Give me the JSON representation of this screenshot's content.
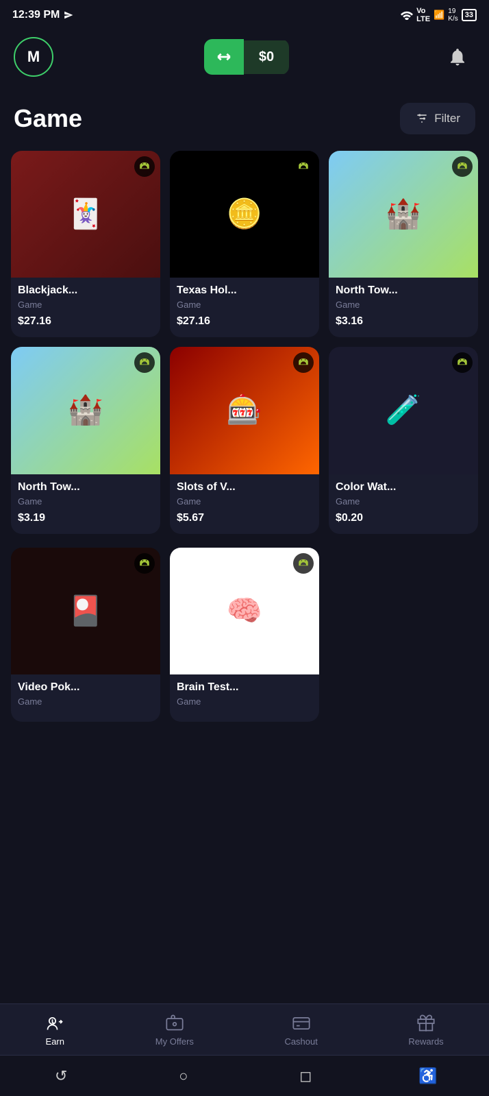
{
  "statusBar": {
    "time": "12:39 PM",
    "battery": "33"
  },
  "header": {
    "avatarLetter": "M",
    "balance": "$0",
    "balanceAriaLabel": "Balance"
  },
  "page": {
    "title": "Game",
    "filterLabel": "Filter"
  },
  "games": [
    {
      "id": "blackjack",
      "name": "Blackjack...",
      "type": "Game",
      "price": "$27.16",
      "bgClass": "game-blackjack",
      "emoji": "🃏"
    },
    {
      "id": "texas",
      "name": "Texas Hol...",
      "type": "Game",
      "price": "$27.16",
      "bgClass": "game-texas",
      "emoji": "🪙"
    },
    {
      "id": "northtow1",
      "name": "North Tow...",
      "type": "Game",
      "price": "$3.16",
      "bgClass": "game-northtow",
      "emoji": "🏰"
    },
    {
      "id": "northtow2",
      "name": "North Tow...",
      "type": "Game",
      "price": "$3.19",
      "bgClass": "game-northtow2",
      "emoji": "🏰"
    },
    {
      "id": "slots",
      "name": "Slots of V...",
      "type": "Game",
      "price": "$5.67",
      "bgClass": "game-slots",
      "emoji": "🎰"
    },
    {
      "id": "colorwater",
      "name": "Color Wat...",
      "type": "Game",
      "price": "$0.20",
      "bgClass": "game-colorwater",
      "emoji": "🧪"
    },
    {
      "id": "videopok",
      "name": "Video Pok...",
      "type": "Game",
      "price": null,
      "bgClass": "game-videopok",
      "emoji": "🎴"
    },
    {
      "id": "braintest",
      "name": "Brain Test...",
      "type": "Game",
      "price": null,
      "bgClass": "game-braintest",
      "emoji": "🧠"
    }
  ],
  "bottomNav": [
    {
      "id": "earn",
      "label": "Earn",
      "active": true
    },
    {
      "id": "myoffers",
      "label": "My Offers",
      "active": false
    },
    {
      "id": "cashout",
      "label": "Cashout",
      "active": false
    },
    {
      "id": "rewards",
      "label": "Rewards",
      "active": false
    }
  ]
}
